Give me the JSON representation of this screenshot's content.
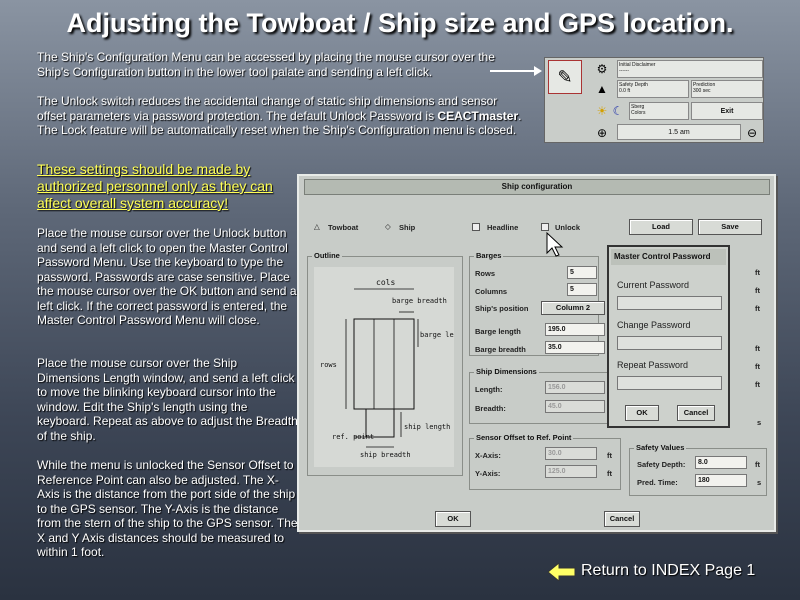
{
  "title": "Adjusting the Towboat / Ship size and GPS location.",
  "intro": {
    "p1": "The Ship's Configuration Menu can be accessed by placing the mouse cursor over the Ship's Configuration button in the lower tool palate and sending a left click.",
    "p2_a": "The Unlock switch reduces the accidental change of static ship dimensions and sensor offset parameters via password protection.  The default Unlock Password is ",
    "p2_pwd": "CEACTmaster",
    "p2_b": ".   The Lock feature will be automatically reset when the Ship's Configuration menu is closed."
  },
  "warning": "These settings should be made by authorized personnel only as they can affect overall system accuracy!",
  "instructions": {
    "p1": "Place the mouse cursor over the Unlock button and send a left click to open the Master Control Password Menu.  Use the keyboard to type the password.  Passwords are case sensitive.  Place the mouse cursor over the OK button and send a left click.  If the correct password is entered, the Master Control Password Menu will close.",
    "p2": "Place the mouse cursor over the Ship Dimensions Length window, and send a left click to move the blinking keyboard cursor into the window.  Edit the Ship's length using the keyboard.   Repeat as above to adjust the Breadth of the ship.",
    "p3": "While the menu is unlocked the Sensor Offset to Reference Point can also be adjusted.  The X-Axis is the distance from the port side of the ship to the GPS sensor. The Y-Axis is the distance from the stern of the ship to the GPS sensor.    The X and Y Axis distances should be measured to within 1 foot."
  },
  "palette": {
    "cell1": "Initial Disclaimer",
    "cell1_val": "------",
    "safety_depth_label": "Safety Depth",
    "safety_depth_val": "0.0 ft",
    "prediction_label": "Prediction",
    "prediction_val": "300 sec",
    "colors_label": "Colors",
    "colors_sub": "Sberg",
    "exit": "Exit",
    "time": "1.5 am"
  },
  "dialog": {
    "title": "Ship configuration",
    "towboat": "Towboat",
    "ship": "Ship",
    "headline": "Headline",
    "unlock": "Unlock",
    "load": "Load",
    "save": "Save",
    "outline": "Outline",
    "diagram": {
      "cols": "cols",
      "barge_breadth": "barge breadth",
      "barge_length": "barge length",
      "rows": "rows",
      "ship_length": "ship length",
      "ref_point": "ref. point",
      "ship_breadth": "ship breadth"
    },
    "barges": "Barges",
    "rows": "Rows",
    "rows_val": "5",
    "columns": "Columns",
    "columns_val": "5",
    "ships_position": "Ship's position",
    "ships_position_val": "Column 2",
    "barge_length": "Barge length",
    "barge_length_val": "195.0",
    "barge_breadth": "Barge breadth",
    "barge_breadth_val": "35.0",
    "ship_dimensions": "Ship Dimensions",
    "length": "Length:",
    "length_val": "156.0",
    "breadth": "Breadth:",
    "breadth_val": "45.0",
    "sensor_offset": "Sensor Offset to Ref. Point",
    "x_axis": "X-Axis:",
    "x_axis_val": "30.0",
    "y_axis": "Y-Axis:",
    "y_axis_val": "125.0",
    "unit_ft": "ft",
    "unit_s": "s",
    "safety_values": "Safety Values",
    "safety_depth": "Safety Depth:",
    "safety_depth_val": "8.0",
    "pred_time": "Pred. Time:",
    "pred_time_val": "180",
    "ok": "OK",
    "cancel": "Cancel"
  },
  "password": {
    "title": "Master Control Password",
    "current": "Current Password",
    "change": "Change Password",
    "repeat": "Repeat Password",
    "ok": "OK",
    "cancel": "Cancel"
  },
  "return_link": "Return to INDEX Page 1",
  "colors": {
    "warning": "#ffff55",
    "arrow": "#ffff66"
  }
}
